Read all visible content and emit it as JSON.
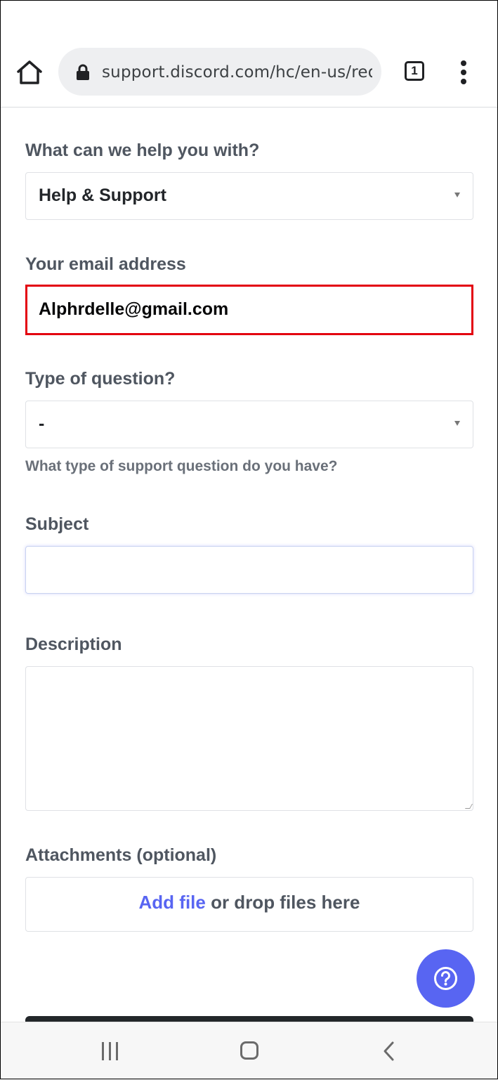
{
  "browser": {
    "url": "support.discord.com/hc/en-us/reques",
    "tab_count": "1"
  },
  "form": {
    "help_label": "What can we help you with?",
    "help_value": "Help & Support",
    "email_label": "Your email address",
    "email_value": "Alphrdelle@gmail.com",
    "type_label": "Type of question?",
    "type_value": "-",
    "type_hint": "What type of support question do you have?",
    "subject_label": "Subject",
    "subject_value": "",
    "description_label": "Description",
    "description_value": "",
    "attachments_label": "Attachments",
    "attachments_optional": "(optional)",
    "add_file": "Add file",
    "drop_text": " or drop files here"
  },
  "colors": {
    "accent": "#5865f2",
    "highlight": "#e3000f"
  },
  "icons": {
    "home": "home-icon",
    "lock": "lock-icon",
    "tabs": "tabs-icon",
    "menu": "more-vert-icon",
    "help": "help-icon",
    "recents": "recents-icon",
    "nav_home": "nav-home-icon",
    "back": "back-icon"
  }
}
